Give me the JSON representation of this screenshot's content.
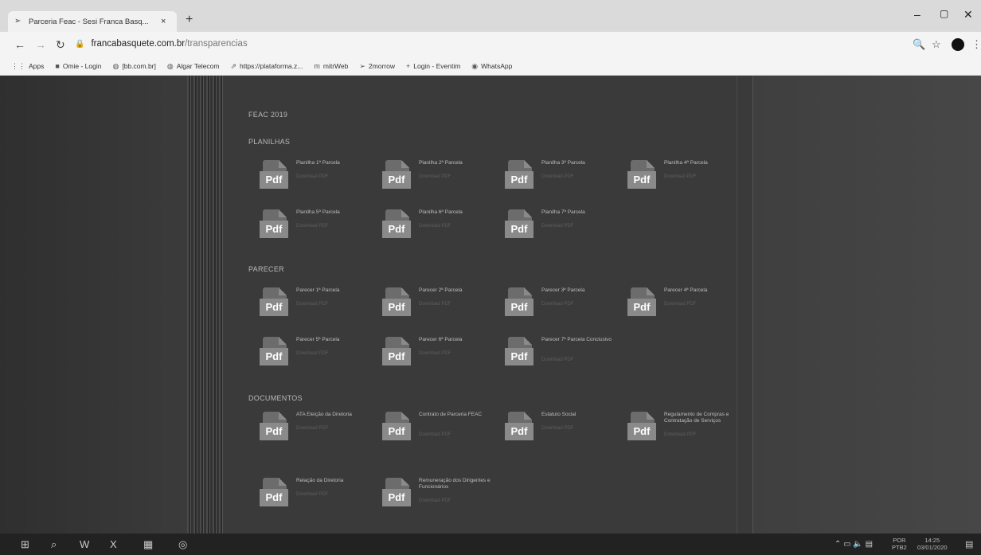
{
  "browser": {
    "tab_title": "Parceria Feac - Sesi Franca Basq...",
    "tab_close": "×",
    "new_tab": "+",
    "address_domain": "francabasquete.com.br",
    "address_path": "/transparencias",
    "bookmarks": [
      {
        "icon": "apps-grid-icon",
        "glyph": "⋮⋮",
        "label": "Apps"
      },
      {
        "icon": "site-icon",
        "glyph": "■",
        "label": "Omie - Login"
      },
      {
        "icon": "globe-icon",
        "glyph": "◍",
        "label": "[bb.com.br]"
      },
      {
        "icon": "globe-icon",
        "glyph": "◍",
        "label": "Algar Telecom"
      },
      {
        "icon": "link-icon",
        "glyph": "⇗",
        "label": "https://plataforma.z..."
      },
      {
        "icon": "site-icon",
        "glyph": "m",
        "label": "mitrWeb"
      },
      {
        "icon": "basketball-icon",
        "glyph": "➢",
        "label": "2morrow"
      },
      {
        "icon": "plus-icon",
        "glyph": "+",
        "label": "Login - Eventim"
      },
      {
        "icon": "whatsapp-icon",
        "glyph": "◉",
        "label": "WhatsApp"
      }
    ]
  },
  "page": {
    "heading": "FEAC 2019",
    "sections": [
      {
        "title": "PLANILHAS",
        "docs": [
          {
            "label": "Planilha 1ª Parcela",
            "sub": "Download PDF"
          },
          {
            "label": "Planilha 2ª Parcela",
            "sub": "Download PDF"
          },
          {
            "label": "Planilha 3ª Parcela",
            "sub": "Download PDF"
          },
          {
            "label": "Planilha 4ª Parcela",
            "sub": "Download PDF"
          },
          {
            "label": "Planilha 5ª Parcela",
            "sub": "Download PDF"
          },
          {
            "label": "Planilha 6ª Parcela",
            "sub": "Download PDF"
          },
          {
            "label": "Planilha 7ª Parcela",
            "sub": "Download PDF"
          }
        ]
      },
      {
        "title": "PARECER",
        "docs": [
          {
            "label": "Parecer 1ª Parcela",
            "sub": "Download PDF"
          },
          {
            "label": "Parecer 2ª Parcela",
            "sub": "Download PDF"
          },
          {
            "label": "Parecer 3ª Parcela",
            "sub": "Download PDF"
          },
          {
            "label": "Parecer 4ª Parcela",
            "sub": "Download PDF"
          },
          {
            "label": "Parecer 5ª Parcela",
            "sub": "Download PDF"
          },
          {
            "label": "Parecer 6ª Parcela",
            "sub": "Download PDF"
          },
          {
            "label": "Parecer 7ª Parcela Conclusivo",
            "sub": "Download PDF"
          }
        ]
      },
      {
        "title": "DOCUMENTOS",
        "docs": [
          {
            "label": "ATA Eleição da Diretoria",
            "sub": "Download PDF"
          },
          {
            "label": "Contrato de Parceria FEAC",
            "sub": "Download PDF"
          },
          {
            "label": "Estatuto Social",
            "sub": "Download PDF"
          },
          {
            "label": "Regulamento de Compras e Contratação de Serviços",
            "sub": "Download PDF"
          },
          {
            "label": "Relação da Diretoria",
            "sub": "Download PDF"
          },
          {
            "label": "Remuneração dos Dirigentes e Funcionários",
            "sub": "Download PDF"
          }
        ]
      }
    ],
    "pdf_badge": "Pdf"
  },
  "taskbar": {
    "lang_top": "POR",
    "lang_bottom": "PTB2",
    "time": "14:25",
    "date": "03/01/2020"
  }
}
